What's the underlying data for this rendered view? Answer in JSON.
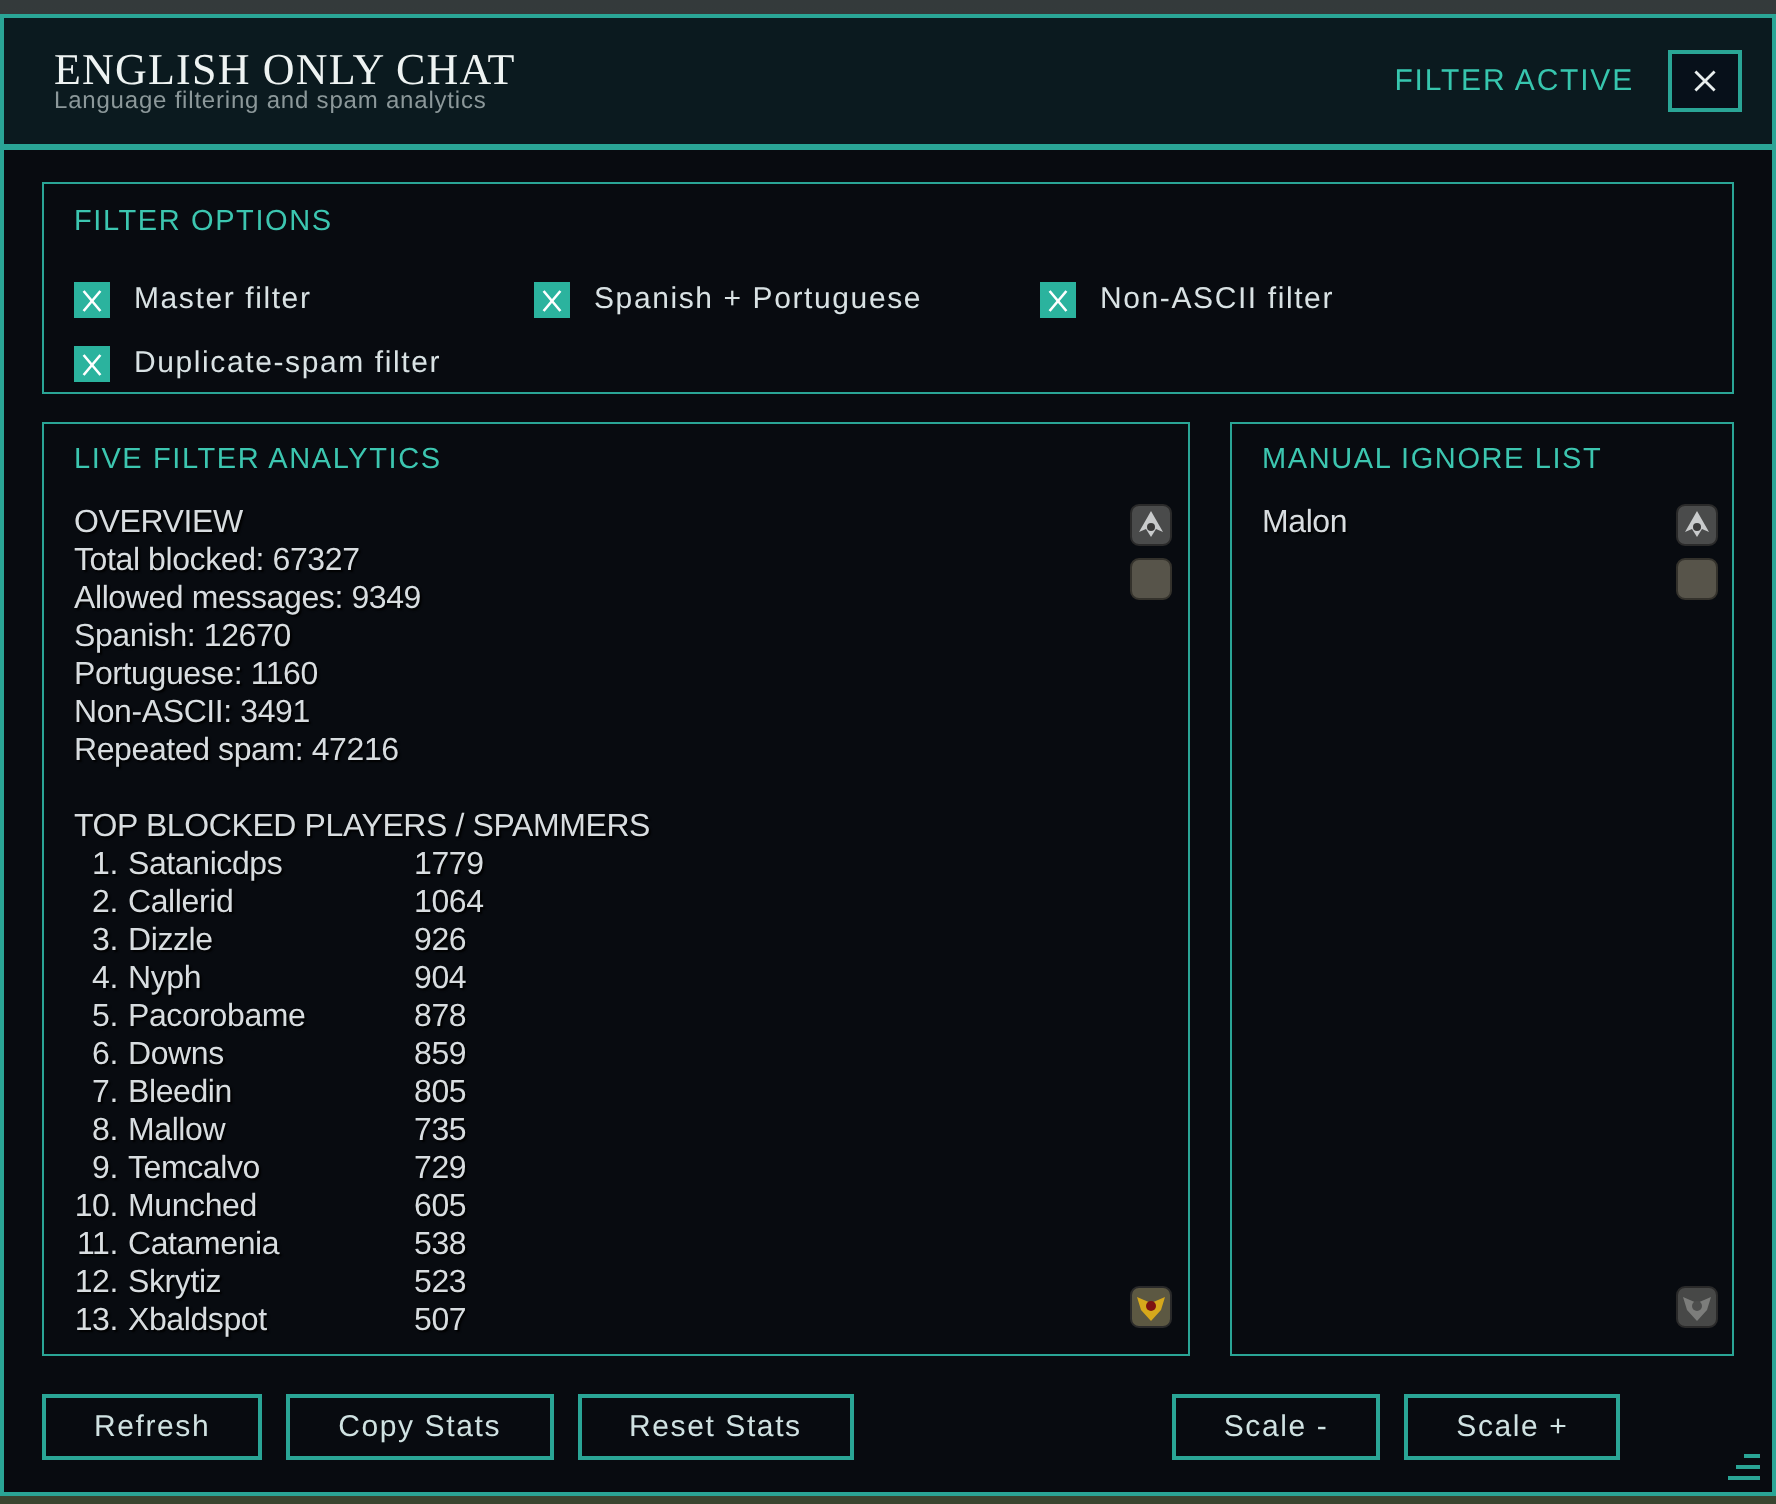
{
  "window": {
    "title": "ENGLISH ONLY CHAT",
    "subtitle": "Language filtering and spam analytics",
    "status": "FILTER ACTIVE"
  },
  "filter_options": {
    "title": "FILTER OPTIONS",
    "items": [
      {
        "label": "Master filter",
        "checked": true
      },
      {
        "label": "Spanish + Portuguese",
        "checked": true
      },
      {
        "label": "Non-ASCII filter",
        "checked": true
      },
      {
        "label": "Duplicate-spam filter",
        "checked": true
      }
    ]
  },
  "analytics": {
    "title": "LIVE FILTER ANALYTICS",
    "overview": {
      "heading": "OVERVIEW",
      "lines": [
        "Total blocked: 67327",
        "Allowed messages: 9349",
        "Spanish: 12670",
        "Portuguese: 1160",
        "Non-ASCII: 3491",
        "Repeated spam: 47216"
      ]
    },
    "top_blocked": {
      "heading": "TOP BLOCKED PLAYERS / SPAMMERS",
      "rows": [
        {
          "rank": "1.",
          "name": "Satanicdps",
          "count": "1779"
        },
        {
          "rank": "2.",
          "name": "Callerid",
          "count": "1064"
        },
        {
          "rank": "3.",
          "name": "Dizzle",
          "count": "926"
        },
        {
          "rank": "4.",
          "name": "Nyph",
          "count": "904"
        },
        {
          "rank": "5.",
          "name": "Pacorobame",
          "count": "878"
        },
        {
          "rank": "6.",
          "name": "Downs",
          "count": "859"
        },
        {
          "rank": "7.",
          "name": "Bleedin",
          "count": "805"
        },
        {
          "rank": "8.",
          "name": "Mallow",
          "count": "735"
        },
        {
          "rank": "9.",
          "name": "Temcalvo",
          "count": "729"
        },
        {
          "rank": "10.",
          "name": "Munched",
          "count": "605"
        },
        {
          "rank": "11.",
          "name": "Catamenia",
          "count": "538"
        },
        {
          "rank": "12.",
          "name": "Skrytiz",
          "count": "523"
        },
        {
          "rank": "13.",
          "name": "Xbaldspot",
          "count": "507"
        }
      ]
    },
    "scroll_down_enabled": true
  },
  "ignore_list": {
    "title": "MANUAL IGNORE LIST",
    "items": [
      "Malon"
    ],
    "scroll_down_enabled": false
  },
  "actions": [
    "Refresh",
    "Copy Stats",
    "Reset Stats"
  ],
  "scale_buttons": [
    "Scale -",
    "Scale +"
  ]
}
